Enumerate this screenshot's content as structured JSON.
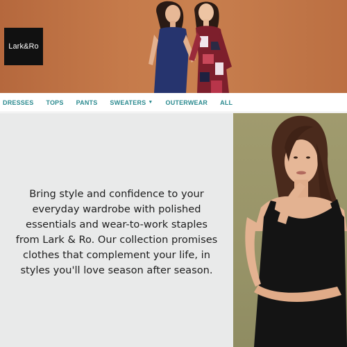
{
  "brand": {
    "logo_text": "Lark&Ro"
  },
  "nav": {
    "items": [
      {
        "label": "DRESSES"
      },
      {
        "label": "TOPS"
      },
      {
        "label": "PANTS"
      },
      {
        "label": "SWEATERS",
        "has_dropdown": true,
        "icon": "caret-down-icon"
      },
      {
        "label": "OUTERWEAR"
      },
      {
        "label": "ALL"
      }
    ]
  },
  "content": {
    "blurb": "Bring style and confidence to your everyday wardrobe with polished essentials and wear-to-work staples from Lark & Ro. Our collection promises clothes that complement your life, in styles you'll love season after season."
  },
  "colors": {
    "hero_background": "#c57a4a",
    "nav_link": "#2b8a8f",
    "text_panel": "#e9eaea",
    "photo_background": "#989468"
  }
}
